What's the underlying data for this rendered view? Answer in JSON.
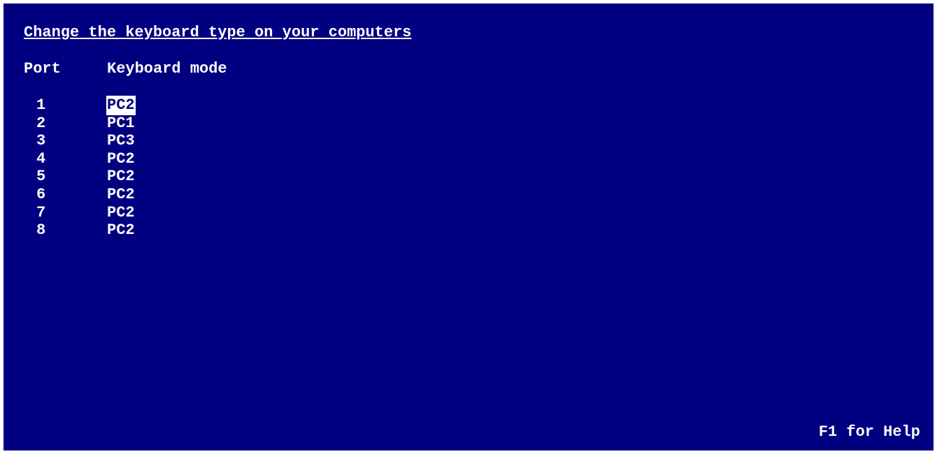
{
  "screen": {
    "title": "Change the keyboard type on your computers",
    "headers": {
      "port": "Port",
      "mode": "Keyboard mode"
    },
    "rows": [
      {
        "port": "1",
        "mode": "PC2",
        "selected": true
      },
      {
        "port": "2",
        "mode": "PC1",
        "selected": false
      },
      {
        "port": "3",
        "mode": "PC3",
        "selected": false
      },
      {
        "port": "4",
        "mode": "PC2",
        "selected": false
      },
      {
        "port": "5",
        "mode": "PC2",
        "selected": false
      },
      {
        "port": "6",
        "mode": "PC2",
        "selected": false
      },
      {
        "port": "7",
        "mode": "PC2",
        "selected": false
      },
      {
        "port": "8",
        "mode": "PC2",
        "selected": false
      }
    ],
    "help_hint": "F1 for Help"
  },
  "colors": {
    "background": "#000080",
    "text": "#ffffff",
    "highlight_bg": "#ffffff",
    "highlight_text": "#000080"
  }
}
